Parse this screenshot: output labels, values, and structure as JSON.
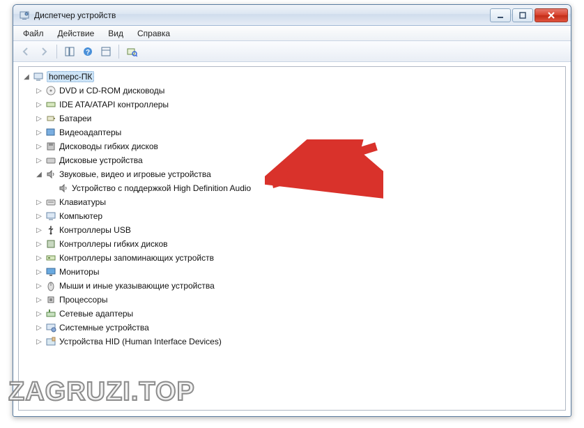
{
  "window": {
    "title": "Диспетчер устройств"
  },
  "menu": {
    "file": "Файл",
    "action": "Действие",
    "view": "Вид",
    "help": "Справка"
  },
  "tree": {
    "root": "homepc-ПК",
    "items": [
      "DVD и CD-ROM дисководы",
      "IDE ATA/ATAPI контроллеры",
      "Батареи",
      "Видеоадаптеры",
      "Дисководы гибких дисков",
      "Дисковые устройства",
      "Звуковые, видео и игровые устройства",
      "Клавиатуры",
      "Компьютер",
      "Контроллеры USB",
      "Контроллеры гибких дисков",
      "Контроллеры запоминающих устройств",
      "Мониторы",
      "Мыши и иные указывающие устройства",
      "Процессоры",
      "Сетевые адаптеры",
      "Системные устройства",
      "Устройства HID (Human Interface Devices)"
    ],
    "audio_child": "Устройство с поддержкой High Definition Audio"
  },
  "watermark": "ZAGRUZI.TOP"
}
